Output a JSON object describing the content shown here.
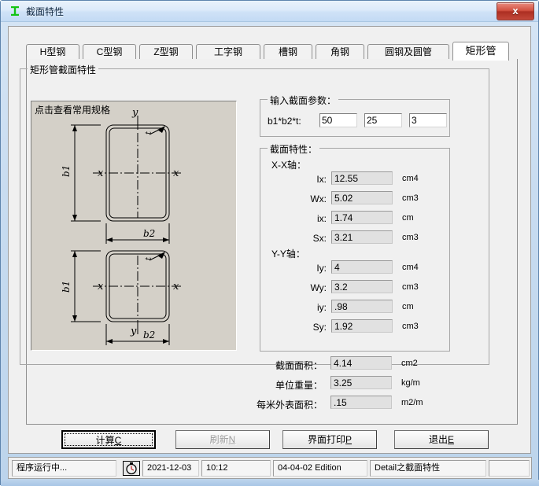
{
  "window": {
    "title": "截面特性",
    "icon": "ibeam-icon",
    "close_label": "x",
    "accent_color": "#c3483a"
  },
  "tabs": [
    {
      "label": "H型钢",
      "active": false
    },
    {
      "label": "C型钢",
      "active": false
    },
    {
      "label": "Z型钢",
      "active": false
    },
    {
      "label": "工字钢",
      "active": false
    },
    {
      "label": "槽钢",
      "active": false
    },
    {
      "label": "角钢",
      "active": false
    },
    {
      "label": "圆钢及圆管",
      "active": false
    },
    {
      "label": "矩形管",
      "active": true
    }
  ],
  "main_group": {
    "legend": "矩形管截面特性"
  },
  "diagram": {
    "hint": "点击查看常用规格",
    "labels": {
      "b1": "b1",
      "b2": "b2",
      "t": "t",
      "x": "x",
      "y": "y"
    },
    "background": "#d4d0c8"
  },
  "input_group": {
    "legend": "输入截面参数：",
    "row_label": "b1*b2*t:",
    "fields": [
      {
        "name": "b1",
        "value": "50"
      },
      {
        "name": "b2",
        "value": "25"
      },
      {
        "name": "t",
        "value": "3"
      }
    ]
  },
  "props_group": {
    "legend": "截面特性：",
    "xx_axis_label": "X-X轴：",
    "yy_axis_label": "Y-Y轴：",
    "xx_rows": [
      {
        "label": "Ix:",
        "value": "12.55",
        "unit": "cm4"
      },
      {
        "label": "Wx:",
        "value": "5.02",
        "unit": "cm3"
      },
      {
        "label": "ix:",
        "value": "1.74",
        "unit": "cm"
      },
      {
        "label": "Sx:",
        "value": "3.21",
        "unit": "cm3"
      }
    ],
    "yy_rows": [
      {
        "label": "Iy:",
        "value": "4",
        "unit": "cm4"
      },
      {
        "label": "Wy:",
        "value": "3.2",
        "unit": "cm3"
      },
      {
        "label": "iy:",
        "value": ".98",
        "unit": "cm"
      },
      {
        "label": "Sy:",
        "value": "1.92",
        "unit": "cm3"
      }
    ],
    "summary_rows": [
      {
        "label": "截面面积：",
        "value": "4.14",
        "unit": "cm2"
      },
      {
        "label": "单位重量：",
        "value": "3.25",
        "unit": "kg/m"
      },
      {
        "label": "每米外表面积：",
        "value": ".15",
        "unit": "m2/m"
      }
    ]
  },
  "buttons": [
    {
      "name": "calculate",
      "text": "计算",
      "mnemonic": "C",
      "state": "focused"
    },
    {
      "name": "refresh",
      "text": "刷新",
      "mnemonic": "N",
      "state": "disabled"
    },
    {
      "name": "print",
      "text": "界面打印",
      "mnemonic": "P",
      "state": "normal"
    },
    {
      "name": "exit",
      "text": "退出",
      "mnemonic": "E",
      "state": "normal"
    }
  ],
  "statusbar": {
    "message": "程序运行中...",
    "clock_icon": "stopwatch-icon",
    "date": "2021-12-03",
    "time": "10:12",
    "edition": "04-04-02 Edition",
    "module": "Detail之截面特性",
    "spare": ""
  }
}
